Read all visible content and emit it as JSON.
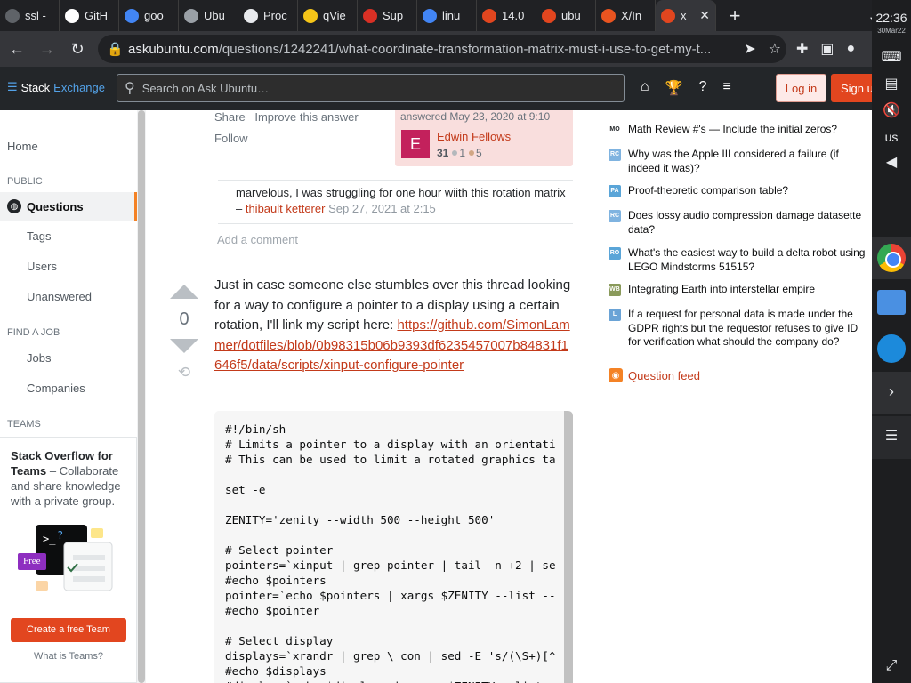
{
  "browser": {
    "tabs": [
      {
        "label": "ssl -",
        "icon": "terminal-icon",
        "color": "#5f6368"
      },
      {
        "label": "GitH",
        "icon": "github-icon",
        "color": "#ffffff"
      },
      {
        "label": "goo",
        "icon": "google-icon",
        "color": "#4285f4"
      },
      {
        "label": "Ubu",
        "icon": "globe-icon",
        "color": "#9aa0a6"
      },
      {
        "label": "Proc",
        "icon": "a-icon",
        "color": "#e8eaed"
      },
      {
        "label": "qVie",
        "icon": "qview-icon",
        "color": "#f5c518"
      },
      {
        "label": "Sup",
        "icon": "support-icon",
        "color": "#d93025"
      },
      {
        "label": "linu",
        "icon": "google-icon",
        "color": "#4285f4"
      },
      {
        "label": "14.0",
        "icon": "askubuntu-icon",
        "color": "#e2461f"
      },
      {
        "label": "ubu",
        "icon": "askubuntu-icon",
        "color": "#e2461f"
      },
      {
        "label": "X/In",
        "icon": "ubuntu-icon",
        "color": "#e95420"
      },
      {
        "label": "x",
        "icon": "askubuntu-icon",
        "color": "#e2461f",
        "active": true
      }
    ],
    "url_host": "askubuntu.com",
    "url_path": "/questions/1242241/what-coordinate-transformation-matrix-must-i-use-to-get-my-t..."
  },
  "se_header": {
    "logo_part1": "Stack",
    "logo_part2": "Exchange",
    "search_placeholder": "Search on Ask Ubuntu…",
    "login": "Log in",
    "signup": "Sign up"
  },
  "leftnav": {
    "home": "Home",
    "public": "PUBLIC",
    "questions": "Questions",
    "tags": "Tags",
    "users": "Users",
    "unanswered": "Unanswered",
    "find_job": "FIND A JOB",
    "jobs": "Jobs",
    "companies": "Companies",
    "teams": "TEAMS",
    "teams_title": "Stack Overflow for Teams",
    "teams_desc": " – Collaborate and share knowledge with a private group.",
    "free_badge": "Free",
    "create_team": "Create a free Team",
    "what_is_teams": "What is Teams?"
  },
  "prev_answer": {
    "share": "Share",
    "improve": "Improve this answer",
    "follow": "Follow",
    "answered": "answered May 23, 2020 at 9:10",
    "avatar_letter": "E",
    "user_name": "Edwin Fellows",
    "reputation": "31",
    "silver": "1",
    "bronze": "5",
    "comment_text": "marvelous, I was struggling for one hour wiith this rotation matrix – ",
    "comment_user": "thibault ketterer",
    "comment_date": "Sep 27, 2021 at 2:15",
    "add_comment": "Add a comment"
  },
  "answer": {
    "votes": "0",
    "text": "Just in case someone else stumbles over this thread looking for a way to configure a pointer to a display using a certain rotation, I'll link my script here:",
    "link": "https://github.com/SimonLammer/dotfiles/blob/0b98315b06b9393df6235457007b84831f1646f5/data/scripts/xinput-configure-pointer",
    "code": "#!/bin/sh\n# Limits a pointer to a display with an orientati\n# This can be used to limit a rotated graphics ta\n\nset -e\n\nZENITY='zenity --width 500 --height 500'\n\n# Select pointer\npointers=`xinput | grep pointer | tail -n +2 | se\n#echo $pointers\npointer=`echo $pointers | xargs $ZENITY --list --\n#echo $pointer\n\n# Select display\ndisplays=`xrandr | grep \\ con | sed -E 's/(\\S+)[^\n#echo $displays\n#display=`echo $displays | xargs $ZENITY --list -"
  },
  "hot_questions": [
    {
      "title": "Math Review #'s — Include the initial zeros?",
      "icon": "MO",
      "color": "#ffffff",
      "fg": "#232629"
    },
    {
      "title": "Why was the Apple III considered a failure (if indeed it was)?",
      "icon": "RC",
      "color": "#7fb3e0",
      "fg": "#ffffff"
    },
    {
      "title": "Proof-theoretic comparison table?",
      "icon": "PA",
      "color": "#5aa5d8",
      "fg": "#ffffff"
    },
    {
      "title": "Does lossy audio compression damage datasette data?",
      "icon": "RC",
      "color": "#7fb3e0",
      "fg": "#ffffff"
    },
    {
      "title": "What's the easiest way to build a delta robot using LEGO Mindstorms 51515?",
      "icon": "RO",
      "color": "#5aa5d8",
      "fg": "#ffffff"
    },
    {
      "title": "Integrating Earth into interstellar empire",
      "icon": "WB",
      "color": "#8a9a5b",
      "fg": "#ffffff"
    },
    {
      "title": "If a request for personal data is made under the GDPR rights but the requestor refuses to give ID for verification what should the company do?",
      "icon": "L",
      "color": "#6aa3d6",
      "fg": "#ffffff"
    }
  ],
  "question_feed": "Question feed",
  "shelf": {
    "time": "22:36",
    "date": "30Mar22",
    "lang": "us"
  }
}
